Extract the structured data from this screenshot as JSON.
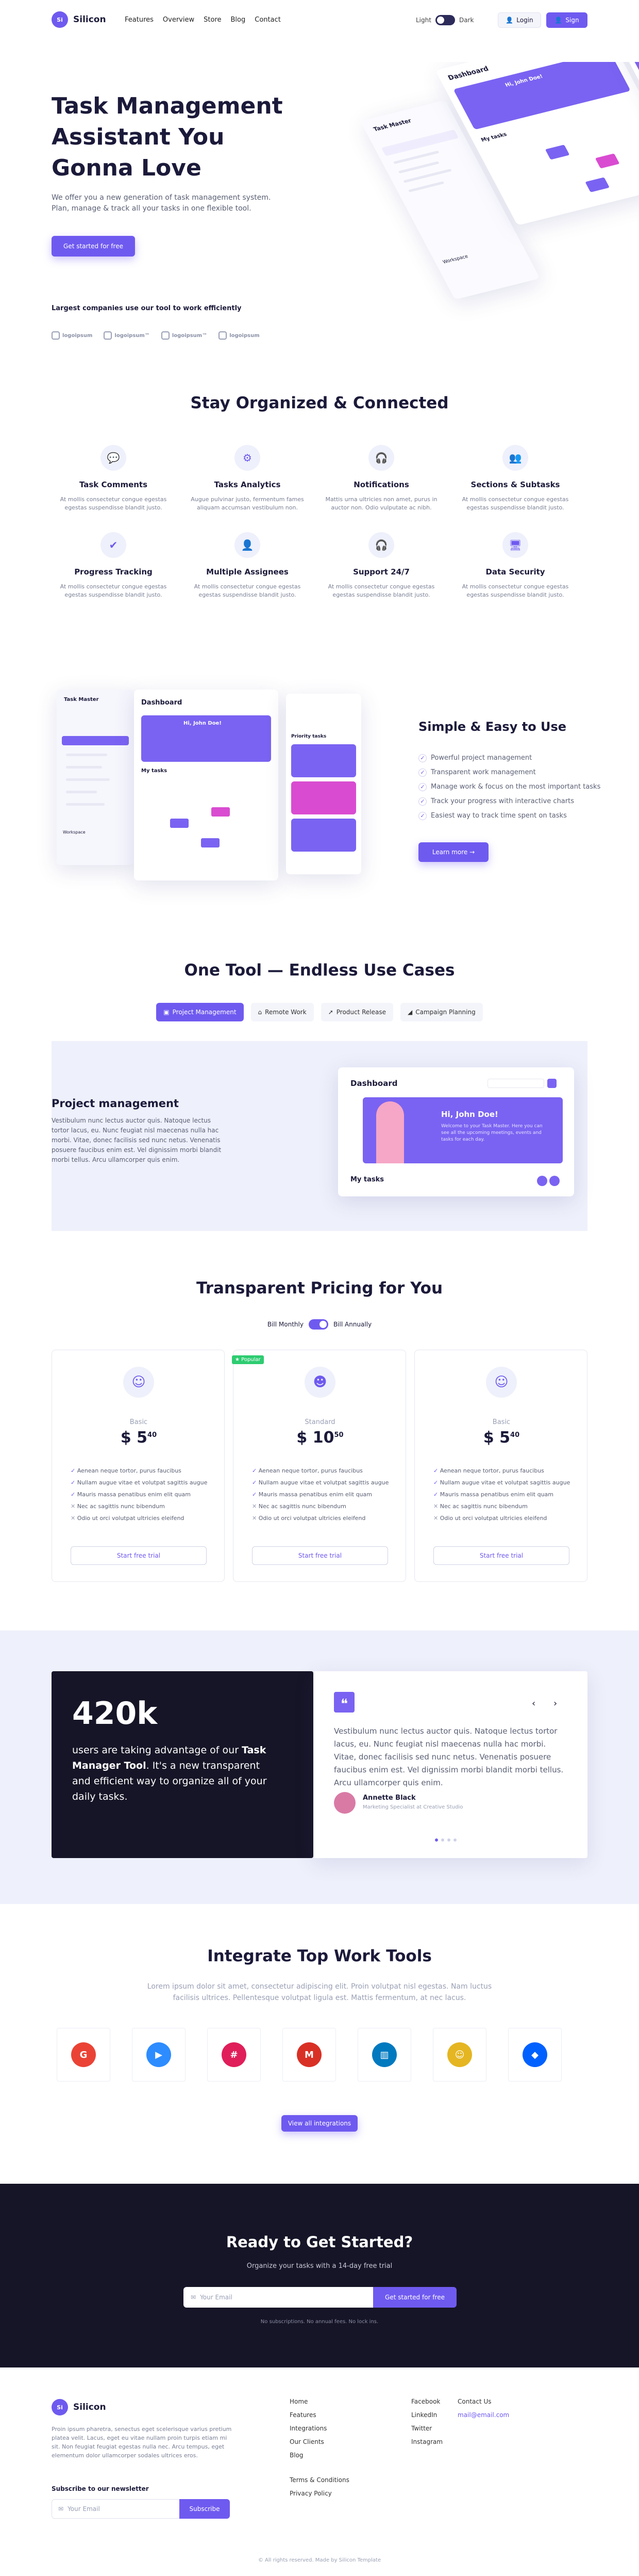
{
  "brand": {
    "name": "Silicon",
    "mark": "Si"
  },
  "nav": {
    "links": [
      "Features",
      "Overview",
      "Store",
      "Blog",
      "Contact"
    ],
    "light": "Light",
    "dark": "Dark",
    "login": "Login",
    "sign": "Sign"
  },
  "hero": {
    "title": "Task Management Assistant You Gonna Love",
    "subtitle": "We offer you a new generation of task management system. Plan, manage & track all your tasks in one flexible tool.",
    "cta": "Get started for free",
    "companies_title": "Largest companies use our tool to work efficiently",
    "companies": [
      "logoipsum",
      "logoipsum™",
      "logoipsum™",
      "logoipsum"
    ]
  },
  "mock": {
    "brand": "Task Master",
    "dashboard": "Dashboard",
    "hello": "Hi, John Doe!",
    "mytasks": "My tasks",
    "priority": "Priority tasks",
    "workspace": "Workspace"
  },
  "features": {
    "title": "Stay Organized & Connected",
    "items": [
      {
        "icon": "💬",
        "title": "Task Comments",
        "desc": "At mollis consectetur congue egestas egestas suspendisse blandit justo."
      },
      {
        "icon": "⚙",
        "title": "Tasks Analytics",
        "desc": "Augue pulvinar justo, fermentum fames aliquam accumsan vestibulum non."
      },
      {
        "icon": "🎧",
        "title": "Notifications",
        "desc": "Mattis urna ultricies non amet, purus in auctor non. Odio vulputate ac nibh."
      },
      {
        "icon": "👥",
        "title": "Sections & Subtasks",
        "desc": "At mollis consectetur congue egestas egestas suspendisse blandit justo."
      },
      {
        "icon": "✔",
        "title": "Progress Tracking",
        "desc": "At mollis consectetur congue egestas egestas suspendisse blandit justo."
      },
      {
        "icon": "👤",
        "title": "Multiple Assignees",
        "desc": "At mollis consectetur congue egestas egestas suspendisse blandit justo."
      },
      {
        "icon": "🎧",
        "title": "Support 24/7",
        "desc": "At mollis consectetur congue egestas egestas suspendisse blandit justo."
      },
      {
        "icon": "🖥",
        "title": "Data Security",
        "desc": "At mollis consectetur congue egestas egestas suspendisse blandit justo."
      }
    ]
  },
  "simple": {
    "title": "Simple & Easy to Use",
    "items": [
      "Powerful project management",
      "Transparent work management",
      "Manage work & focus on the most important tasks",
      "Track your progress with interactive charts",
      "Easiest way to track time spent on tasks"
    ],
    "cta": "Learn more →"
  },
  "usecases": {
    "title": "One Tool — Endless Use Cases",
    "tabs": [
      "Project Management",
      "Remote Work",
      "Product Release",
      "Campaign Planning"
    ],
    "heading": "Project management",
    "text": "Vestibulum nunc lectus auctor quis. Natoque lectus tortor lacus, eu. Nunc feugiat nisl maecenas nulla hac morbi. Vitae, donec facilisis sed nunc netus. Venenatis posuere faucibus enim est. Vel dignissim morbi blandit morbi tellus. Arcu ullamcorper quis enim.",
    "dash": "Dashboard",
    "hello": "Hi, John Doe!",
    "sub": "Welcome to your Task Master. Here you can see all the upcoming meetings, events and tasks for each day.",
    "mytasks": "My tasks"
  },
  "pricing": {
    "title": "Transparent Pricing for You",
    "monthly": "Bill Monthly",
    "annually": "Bill Annually",
    "popular": "Popular",
    "plans": [
      {
        "name": "Basic",
        "price": "$ 5",
        "cents": "40"
      },
      {
        "name": "Standard",
        "price": "$ 10",
        "cents": "50"
      },
      {
        "name": "Basic",
        "price": "$ 5",
        "cents": "40"
      }
    ],
    "features": [
      "Aenean neque tortor, purus faucibus",
      "Nullam augue vitae et volutpat sagittis augue",
      "Mauris massa penatibus enim elit quam",
      "Nec ac sagittis nunc bibendum",
      "Odio ut orci volutpat ultricies eleifend"
    ],
    "trial": "Start free trial"
  },
  "testimonial": {
    "number": "420k",
    "text_a": "users are taking advantage of our ",
    "text_b": "Task Manager Tool",
    "text_c": ". It's a new transparent and efficient way to organize all of your daily tasks.",
    "quote": "Vestibulum nunc lectus auctor quis. Natoque lectus tortor lacus, eu. Nunc feugiat nisl maecenas nulla hac morbi. Vitae, donec facilisis sed nunc netus. Venenatis posuere faucibus enim est. Vel dignissim morbi blandit morbi tellus. Arcu ullamcorper quis enim.",
    "name": "Annette Black",
    "role": "Marketing Specialist at Creative Studio"
  },
  "tools": {
    "title": "Integrate Top Work Tools",
    "desc": "Lorem ipsum dolor sit amet, consectetur adipiscing elit. Proin volutpat nisl egestas. Nam luctus facilisis ultrices. Pellentesque volutpat ligula est. Mattis fermentum, at nec lacus.",
    "items": [
      {
        "icon": "google-icon",
        "glyph": "G",
        "color": "#ea4335"
      },
      {
        "icon": "zoom-icon",
        "glyph": "▶",
        "color": "#2d8cff"
      },
      {
        "icon": "slack-icon",
        "glyph": "#",
        "color": "#e01e5a"
      },
      {
        "icon": "gmail-icon",
        "glyph": "M",
        "color": "#d93025"
      },
      {
        "icon": "trello-icon",
        "glyph": "▥",
        "color": "#0079bf"
      },
      {
        "icon": "mailchimp-icon",
        "glyph": "☺",
        "color": "#e5b622"
      },
      {
        "icon": "dropbox-icon",
        "glyph": "◆",
        "color": "#0061fe"
      }
    ],
    "cta": "View all integrations"
  },
  "cta": {
    "title": "Ready to Get Started?",
    "sub": "Organize your tasks with a 14-day free trial",
    "placeholder": "Your Email",
    "button": "Get started for free",
    "note": "No subscriptions. No annual fees. No lock ins."
  },
  "footer": {
    "text": "Proin ipsum pharetra, senectus eget scelerisque varius pretium platea velit. Lacus, eget eu vitae nullam proin turpis etiam mi sit. Non feugiat feugiat egestas nulla nec. Arcu tempus, eget elementum dolor ullamcorper sodales ultrices eros.",
    "newsletter": "Subscribe to our newsletter",
    "placeholder": "Your Email",
    "subscribe": "Subscribe",
    "col1": [
      "Home",
      "Features",
      "Integrations",
      "Our Clients",
      "Blog"
    ],
    "col1b": [
      "Terms & Conditions",
      "Privacy Policy"
    ],
    "col2": [
      "Facebook",
      "LinkedIn",
      "Twitter",
      "Instagram"
    ],
    "contact": "Contact Us",
    "email": "mail@email.com",
    "copyright": "© All rights reserved. Made by Silicon Template"
  }
}
